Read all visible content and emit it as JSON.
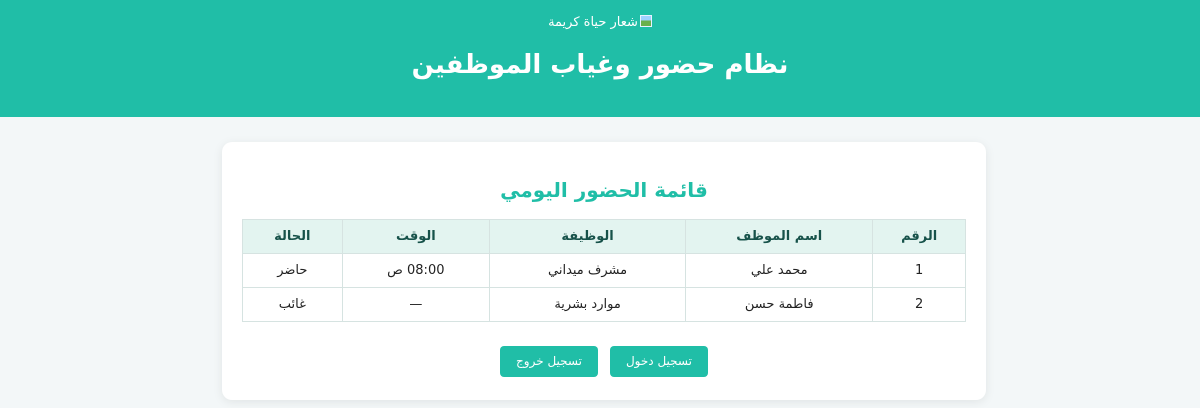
{
  "header": {
    "logo_alt": "شعار حياة كريمة",
    "title": "نظام حضور وغياب الموظفين"
  },
  "card": {
    "title": "قائمة الحضور اليومي",
    "table": {
      "columns": [
        "الرقم",
        "اسم الموظف",
        "الوظيفة",
        "الوقت",
        "الحالة"
      ],
      "rows": [
        [
          "1",
          "محمد علي",
          "مشرف ميداني",
          "08:00 ص",
          "حاضر"
        ],
        [
          "2",
          "فاطمة حسن",
          "موارد بشرية",
          "—",
          "غائب"
        ]
      ]
    },
    "buttons": {
      "check_in": "تسجيل دخول",
      "check_out": "تسجيل خروج"
    }
  },
  "colors": {
    "accent": "#20bea7",
    "table_header_bg": "#e3f4f0"
  }
}
